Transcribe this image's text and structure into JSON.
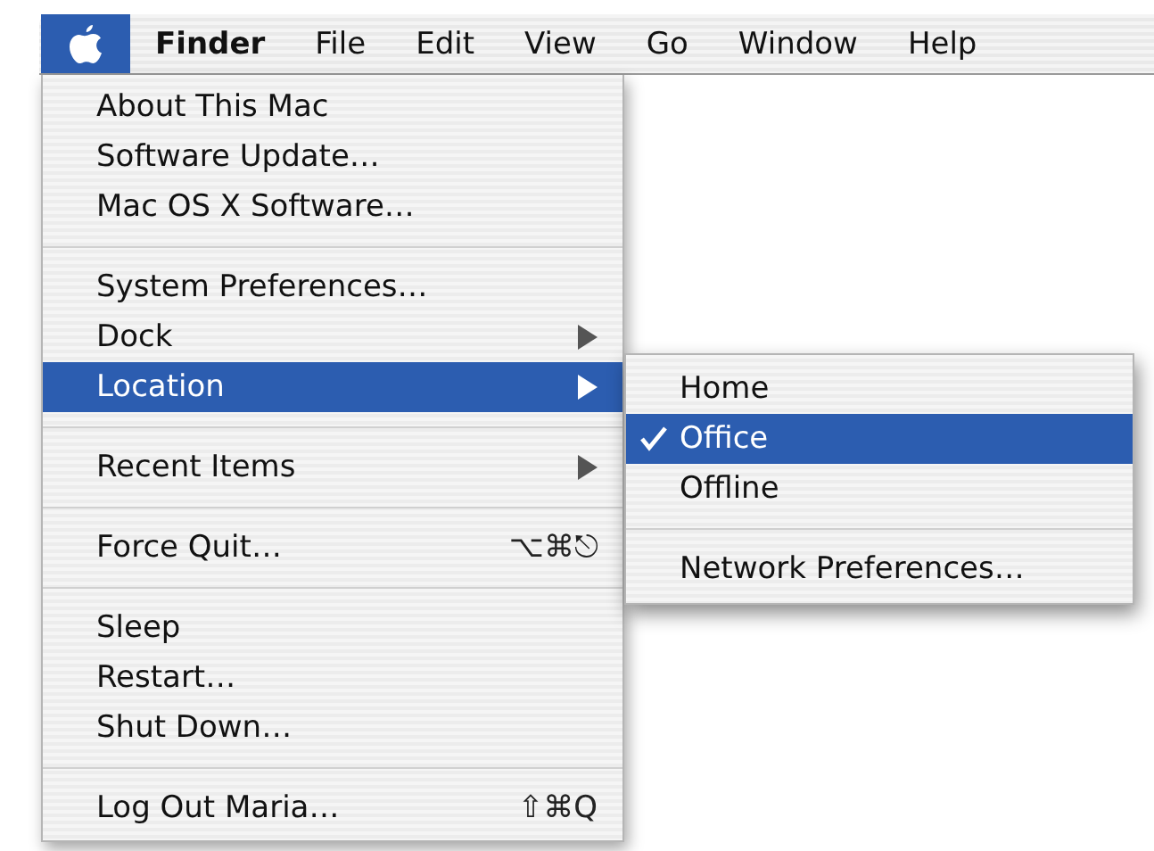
{
  "menubar": [
    {
      "kind": "apple",
      "selected": true
    },
    {
      "kind": "app",
      "label": "Finder",
      "selected": false
    },
    {
      "kind": "menu",
      "label": "File",
      "selected": false
    },
    {
      "kind": "menu",
      "label": "Edit",
      "selected": false
    },
    {
      "kind": "menu",
      "label": "View",
      "selected": false
    },
    {
      "kind": "menu",
      "label": "Go",
      "selected": false
    },
    {
      "kind": "menu",
      "label": "Window",
      "selected": false
    },
    {
      "kind": "menu",
      "label": "Help",
      "selected": false
    }
  ],
  "apple_menu": [
    {
      "kind": "item",
      "label": "About This Mac",
      "selected": false
    },
    {
      "kind": "item",
      "label": "Software Update…",
      "selected": false
    },
    {
      "kind": "item",
      "label": "Mac OS X Software…",
      "selected": false
    },
    {
      "kind": "separator"
    },
    {
      "kind": "item",
      "label": "System Preferences…",
      "selected": false
    },
    {
      "kind": "item",
      "label": "Dock",
      "selected": false,
      "submenu": true
    },
    {
      "kind": "item",
      "label": "Location",
      "selected": true,
      "submenu": true
    },
    {
      "kind": "separator"
    },
    {
      "kind": "item",
      "label": "Recent Items",
      "selected": false,
      "submenu": true
    },
    {
      "kind": "separator"
    },
    {
      "kind": "item",
      "label": "Force Quit…",
      "selected": false,
      "shortcut": "⌥⌘⎋"
    },
    {
      "kind": "separator"
    },
    {
      "kind": "item",
      "label": "Sleep",
      "selected": false
    },
    {
      "kind": "item",
      "label": "Restart…",
      "selected": false
    },
    {
      "kind": "item",
      "label": "Shut Down…",
      "selected": false
    },
    {
      "kind": "separator"
    },
    {
      "kind": "item",
      "label": "Log Out Maria…",
      "selected": false,
      "shortcut": "⇧⌘Q"
    }
  ],
  "location_submenu": [
    {
      "kind": "item",
      "label": "Home",
      "selected": false,
      "checked": false
    },
    {
      "kind": "item",
      "label": "Office",
      "selected": true,
      "checked": true
    },
    {
      "kind": "item",
      "label": "Offline",
      "selected": false,
      "checked": false
    },
    {
      "kind": "separator"
    },
    {
      "kind": "item",
      "label": "Network Preferences…",
      "selected": false,
      "checked": false
    }
  ]
}
